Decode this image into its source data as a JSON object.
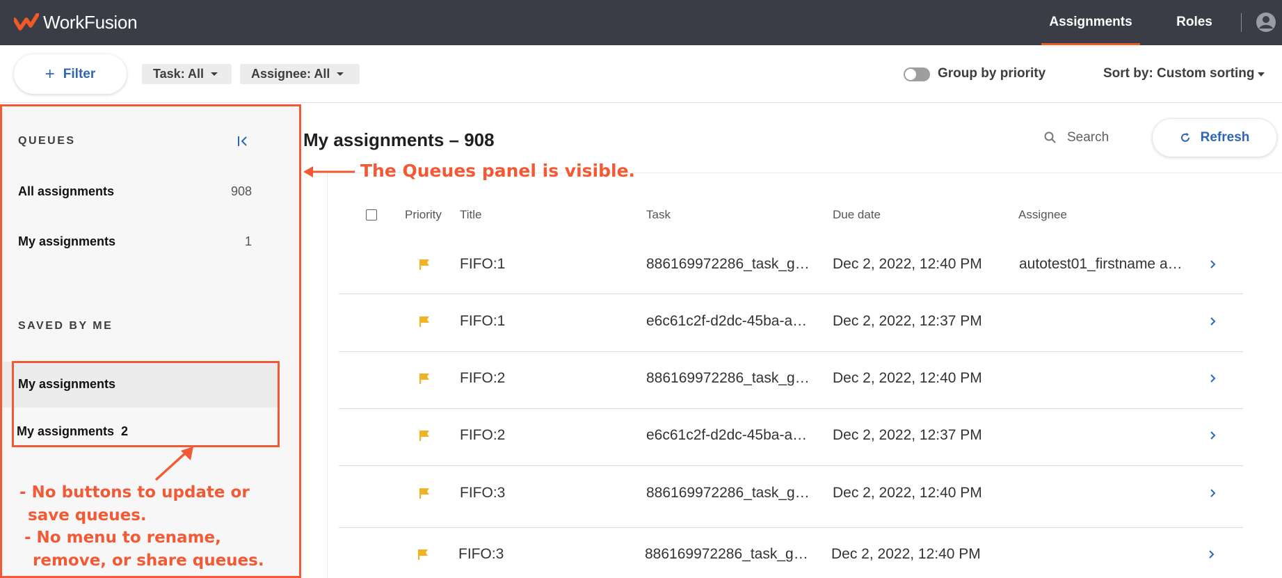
{
  "app": {
    "brand": "WorkFusion"
  },
  "topnav": {
    "tabs": [
      {
        "label": "Assignments"
      },
      {
        "label": "Roles"
      }
    ]
  },
  "filterbar": {
    "filter_label": "Filter",
    "task_chip": "Task: All",
    "assignee_chip": "Assignee: All",
    "group_by_label": "Group by priority",
    "sort_label": "Sort by: Custom sorting"
  },
  "sidebar": {
    "queues_title": "QUEUES",
    "queues": [
      {
        "label": "All assignments",
        "count": "908"
      },
      {
        "label": "My assignments",
        "count": "1"
      }
    ],
    "saved_title": "SAVED BY ME",
    "saved": [
      {
        "label": "My assignments"
      },
      {
        "label": "My assignments  2"
      }
    ]
  },
  "main": {
    "title": "My assignments – 908",
    "search_placeholder": "Search",
    "refresh_label": "Refresh",
    "columns": [
      "Priority",
      "Title",
      "Task",
      "Due date",
      "Assignee"
    ],
    "rows": [
      {
        "title": "FIFO:1",
        "task": "886169972286_task_g…",
        "due": "Dec 2, 2022, 12:40 PM",
        "assignee": "autotest01_firstname a…"
      },
      {
        "title": "FIFO:1",
        "task": "e6c61c2f-d2dc-45ba-a…",
        "due": "Dec 2, 2022, 12:37 PM",
        "assignee": ""
      },
      {
        "title": "FIFO:2",
        "task": "886169972286_task_g…",
        "due": "Dec 2, 2022, 12:40 PM",
        "assignee": ""
      },
      {
        "title": "FIFO:2",
        "task": "e6c61c2f-d2dc-45ba-a…",
        "due": "Dec 2, 2022, 12:37 PM",
        "assignee": ""
      },
      {
        "title": "FIFO:3",
        "task": "886169972286_task_g…",
        "due": "Dec 2, 2022, 12:40 PM",
        "assignee": ""
      },
      {
        "title": "FIFO:3",
        "task": "886169972286_task_g…",
        "due": "Dec 2, 2022, 12:40 PM",
        "assignee": ""
      }
    ]
  },
  "annotations": {
    "panel_visible": "The Queues panel is visible.",
    "no_buttons_1": "- No buttons to update or",
    "no_buttons_2": "save queues.",
    "no_menu_1": "- No menu to rename,",
    "no_menu_2": "remove, or share queues."
  },
  "colors": {
    "topbar": "#3a3d46",
    "accent": "#f05a28",
    "link": "#2f66b3",
    "flag": "#f0b323",
    "annotation": "#f25a36"
  }
}
